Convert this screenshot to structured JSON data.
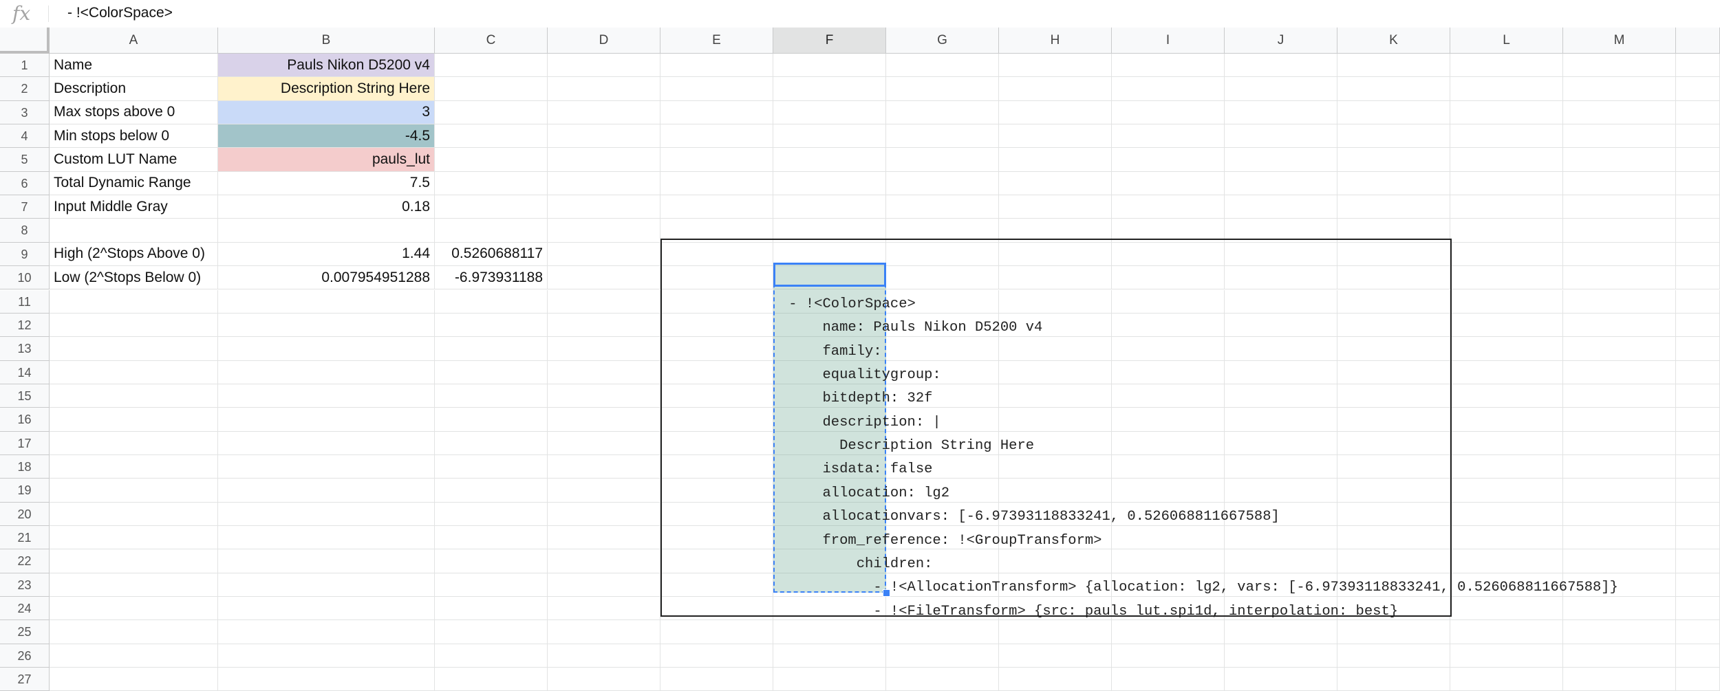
{
  "formula_bar": {
    "icon": "fx-icon",
    "value": "- !<ColorSpace>"
  },
  "columns": [
    "A",
    "B",
    "C",
    "D",
    "E",
    "F",
    "G",
    "H",
    "I",
    "J",
    "K",
    "L",
    "M"
  ],
  "rows": [
    "1",
    "2",
    "3",
    "4",
    "5",
    "6",
    "7",
    "8",
    "9",
    "10",
    "11",
    "12",
    "13",
    "14",
    "15",
    "16",
    "17",
    "18",
    "19",
    "20",
    "21",
    "22",
    "23",
    "24",
    "25",
    "26",
    "27"
  ],
  "cells": {
    "A1": "Name",
    "B1": "Pauls Nikon D5200 v4",
    "A2": "Description",
    "B2": "Description String Here",
    "A3": "Max stops above 0",
    "B3": "3",
    "A4": "Min stops below 0",
    "B4": "-4.5",
    "A5": "Custom LUT Name",
    "B5": "pauls_lut",
    "A6": "Total Dynamic Range",
    "B6": "7.5",
    "A7": "Input Middle Gray",
    "B7": "0.18",
    "A9": "High (2^Stops Above 0)",
    "B9": "1.44",
    "C9": "0.5260688117",
    "A10": "Low (2^Stops Below 0)",
    "B10": "0.007954951288",
    "C10": "-6.973931188"
  },
  "fill_colors": {
    "B1": "#d9d2e9",
    "B2": "#fff2cc",
    "B3": "#c9daf8",
    "B4": "#a2c4c9",
    "B5": "#f4cccc"
  },
  "yaml_lines": [
    " - !<ColorSpace>",
    "     name: Pauls Nikon D5200 v4",
    "     family:",
    "     equalitygroup:",
    "     bitdepth: 32f",
    "     description: |",
    "       Description String Here",
    "     isdata: false",
    "     allocation: lg2",
    "     allocationvars: [-6.97393118833241, 0.526068811667588]",
    "     from_reference: !<GroupTransform>",
    "         children:",
    "           - !<AllocationTransform> {allocation: lg2, vars: [-6.97393118833241, 0.526068811667588]}",
    "           - !<FileTransform> {src: pauls_lut.spi1d, interpolation: best}"
  ],
  "selection": {
    "active_column": "F",
    "active_row": "11",
    "range": "F11:F24"
  }
}
